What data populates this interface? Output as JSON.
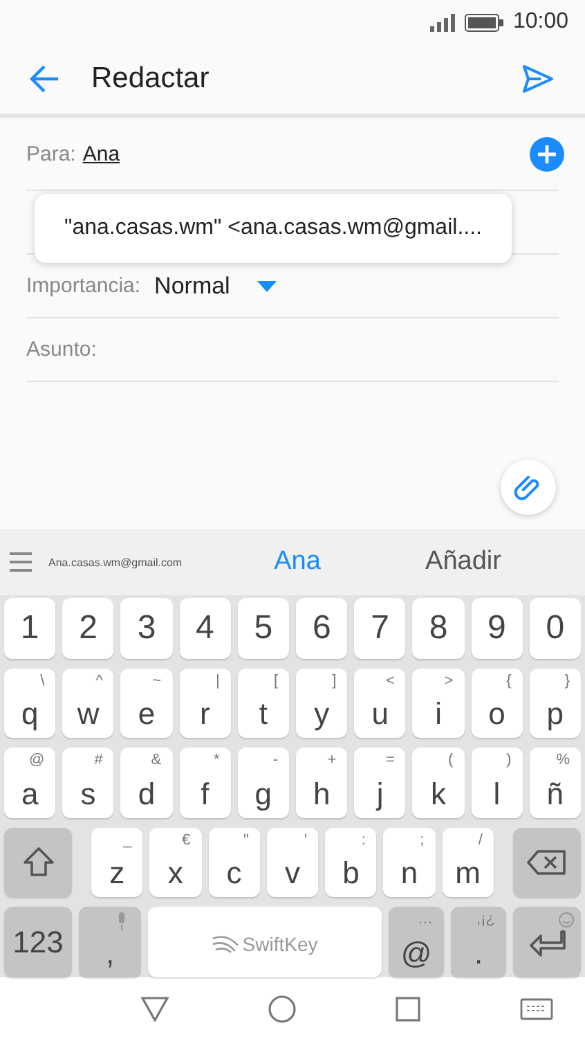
{
  "status_bar": {
    "time": "10:00"
  },
  "header": {
    "title": "Redactar"
  },
  "to": {
    "label": "Para:",
    "value": "Ana"
  },
  "suggestion_popup": {
    "text": "\"ana.casas.wm\" <ana.casas.wm@gmail...."
  },
  "importance": {
    "label": "Importancia:",
    "value": "Normal"
  },
  "subject": {
    "label": "Asunto:"
  },
  "prediction_bar": {
    "email": "Ana.casas.wm@gmail.com",
    "items": [
      {
        "text": "Ana",
        "selected": true
      },
      {
        "text": "Añadir",
        "selected": false
      }
    ]
  },
  "keyboard": {
    "rows": [
      {
        "keys": [
          {
            "kind": "num",
            "main": "1"
          },
          {
            "kind": "num",
            "main": "2"
          },
          {
            "kind": "num",
            "main": "3"
          },
          {
            "kind": "num",
            "main": "4"
          },
          {
            "kind": "num",
            "main": "5"
          },
          {
            "kind": "num",
            "main": "6"
          },
          {
            "kind": "num",
            "main": "7"
          },
          {
            "kind": "num",
            "main": "8"
          },
          {
            "kind": "num",
            "main": "9"
          },
          {
            "kind": "num",
            "main": "0"
          }
        ]
      },
      {
        "keys": [
          {
            "kind": "char",
            "main": "q",
            "hint": "\\"
          },
          {
            "kind": "char",
            "main": "w",
            "hint": "^"
          },
          {
            "kind": "char",
            "main": "e",
            "hint": "~"
          },
          {
            "kind": "char",
            "main": "r",
            "hint": "|"
          },
          {
            "kind": "char",
            "main": "t",
            "hint": "["
          },
          {
            "kind": "char",
            "main": "y",
            "hint": "]"
          },
          {
            "kind": "char",
            "main": "u",
            "hint": "<"
          },
          {
            "kind": "char",
            "main": "i",
            "hint": ">"
          },
          {
            "kind": "char",
            "main": "o",
            "hint": "{"
          },
          {
            "kind": "char",
            "main": "p",
            "hint": "}"
          }
        ]
      },
      {
        "keys": [
          {
            "kind": "char",
            "main": "a",
            "hint": "@"
          },
          {
            "kind": "char",
            "main": "s",
            "hint": "#"
          },
          {
            "kind": "char",
            "main": "d",
            "hint": "&"
          },
          {
            "kind": "char",
            "main": "f",
            "hint": "*"
          },
          {
            "kind": "char",
            "main": "g",
            "hint": "-"
          },
          {
            "kind": "char",
            "main": "h",
            "hint": "+"
          },
          {
            "kind": "char",
            "main": "j",
            "hint": "="
          },
          {
            "kind": "char",
            "main": "k",
            "hint": "("
          },
          {
            "kind": "char",
            "main": "l",
            "hint": ")"
          },
          {
            "kind": "char",
            "main": "ñ",
            "hint": "%"
          }
        ]
      },
      {
        "keys": [
          {
            "kind": "shift"
          },
          {
            "kind": "char",
            "main": "z",
            "hint": "_"
          },
          {
            "kind": "char",
            "main": "x",
            "hint": "€"
          },
          {
            "kind": "char",
            "main": "c",
            "hint": "\""
          },
          {
            "kind": "char",
            "main": "v",
            "hint": "'"
          },
          {
            "kind": "char",
            "main": "b",
            "hint": ":"
          },
          {
            "kind": "char",
            "main": "n",
            "hint": ";"
          },
          {
            "kind": "char",
            "main": "m",
            "hint": "/"
          },
          {
            "kind": "backspace"
          }
        ]
      },
      {
        "keys": [
          {
            "kind": "mode",
            "main": "123"
          },
          {
            "kind": "mic",
            "main": ","
          },
          {
            "kind": "space",
            "main": "SwiftKey"
          },
          {
            "kind": "func",
            "main": "@",
            "hint": "…"
          },
          {
            "kind": "func",
            "main": ".",
            "hint": ",¡¿"
          },
          {
            "kind": "enter"
          }
        ]
      }
    ]
  }
}
